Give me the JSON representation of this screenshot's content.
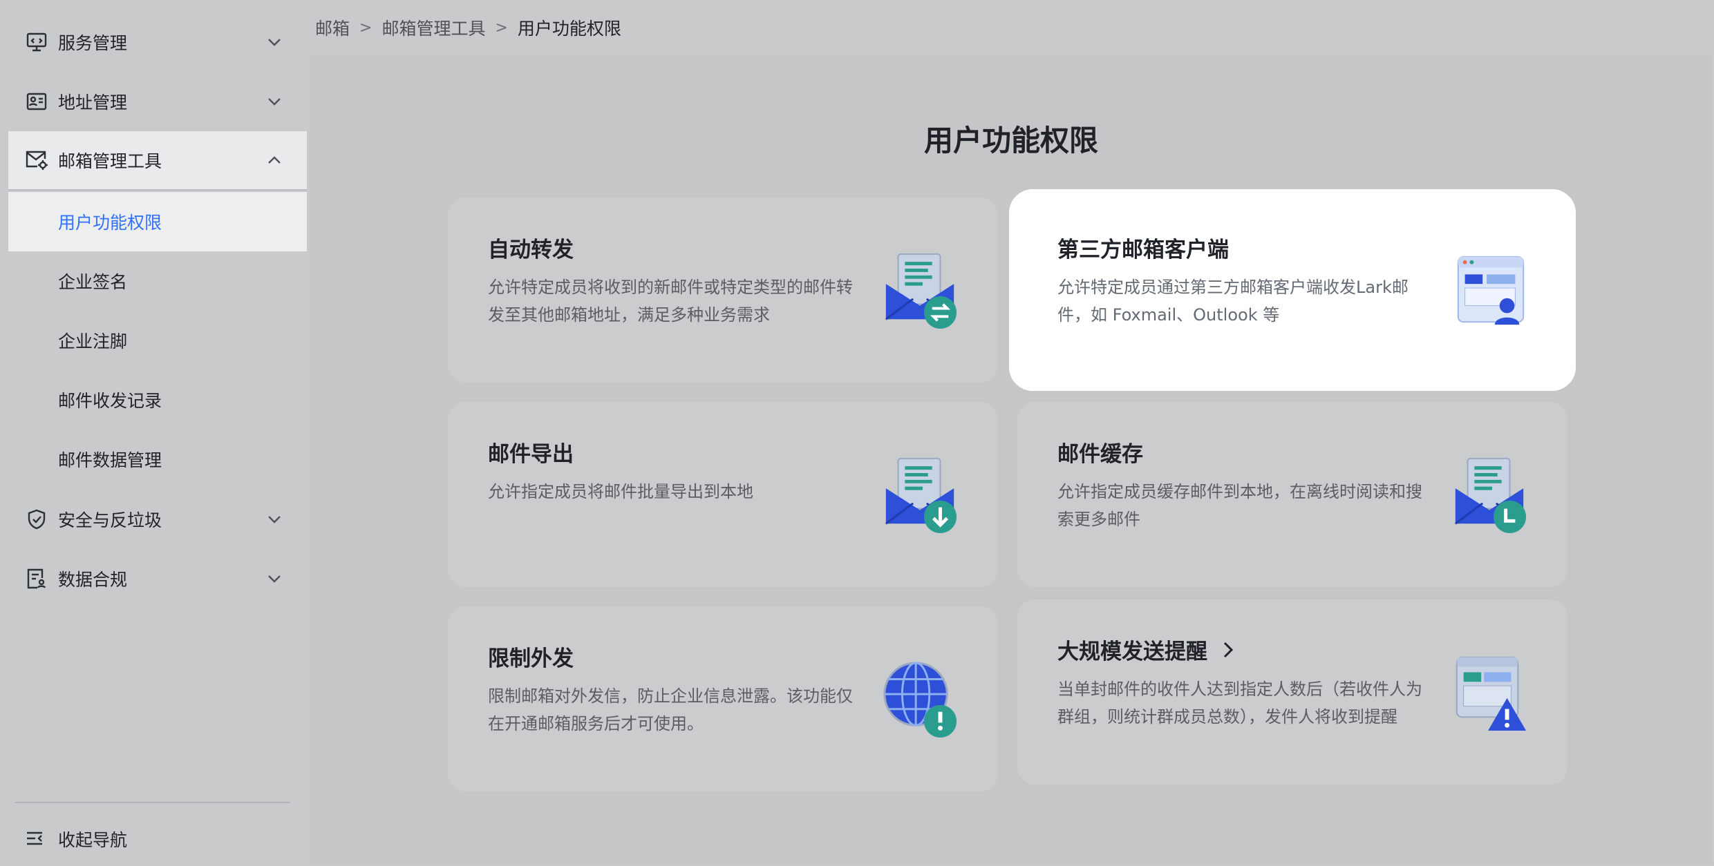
{
  "sidebar": {
    "items": [
      {
        "label": "服务管理",
        "icon": "monitor-icon",
        "expanded": false
      },
      {
        "label": "地址管理",
        "icon": "id-card-icon",
        "expanded": false
      },
      {
        "label": "邮箱管理工具",
        "icon": "mail-settings-icon",
        "expanded": true
      },
      {
        "label": "安全与反垃圾",
        "icon": "shield-icon",
        "expanded": false
      },
      {
        "label": "数据合规",
        "icon": "compliance-doc-icon",
        "expanded": false
      }
    ],
    "sub_items": [
      {
        "label": "用户功能权限",
        "active": true
      },
      {
        "label": "企业签名",
        "active": false
      },
      {
        "label": "企业注脚",
        "active": false
      },
      {
        "label": "邮件收发记录",
        "active": false
      },
      {
        "label": "邮件数据管理",
        "active": false
      }
    ],
    "collapse_label": "收起导航"
  },
  "breadcrumb": {
    "items": [
      "邮箱",
      "邮箱管理工具",
      "用户功能权限"
    ],
    "separator": ">"
  },
  "main": {
    "title": "用户功能权限",
    "cards": [
      {
        "title": "自动转发",
        "desc": "允许特定成员将收到的新邮件或特定类型的邮件转发至其他邮箱地址，满足多种业务需求",
        "icon": "mail-forward-icon"
      },
      {
        "title": "第三方邮箱客户端",
        "desc": "允许特定成员通过第三方邮箱客户端收发Lark邮件，如 Foxmail、Outlook 等",
        "icon": "third-party-client-icon"
      },
      {
        "title": "邮件导出",
        "desc": "允许指定成员将邮件批量导出到本地",
        "icon": "mail-export-icon"
      },
      {
        "title": "邮件缓存",
        "desc": "允许指定成员缓存邮件到本地，在离线时阅读和搜索更多邮件",
        "icon": "mail-cache-icon"
      },
      {
        "title": "限制外发",
        "desc": "限制邮箱对外发信，防止企业信息泄露。该功能仅在开通邮箱服务后才可使用。",
        "icon": "globe-warning-icon"
      },
      {
        "title": "大规模发送提醒",
        "desc": "当单封邮件的收件人达到指定人数后（若收件人为群组，则统计群成员总数），发件人将收到提醒",
        "icon": "mass-send-warning-icon"
      }
    ]
  },
  "colors": {
    "accent": "#3370ff",
    "illustration_blue": "#2e4fd8",
    "illustration_teal": "#2a9d8f"
  }
}
